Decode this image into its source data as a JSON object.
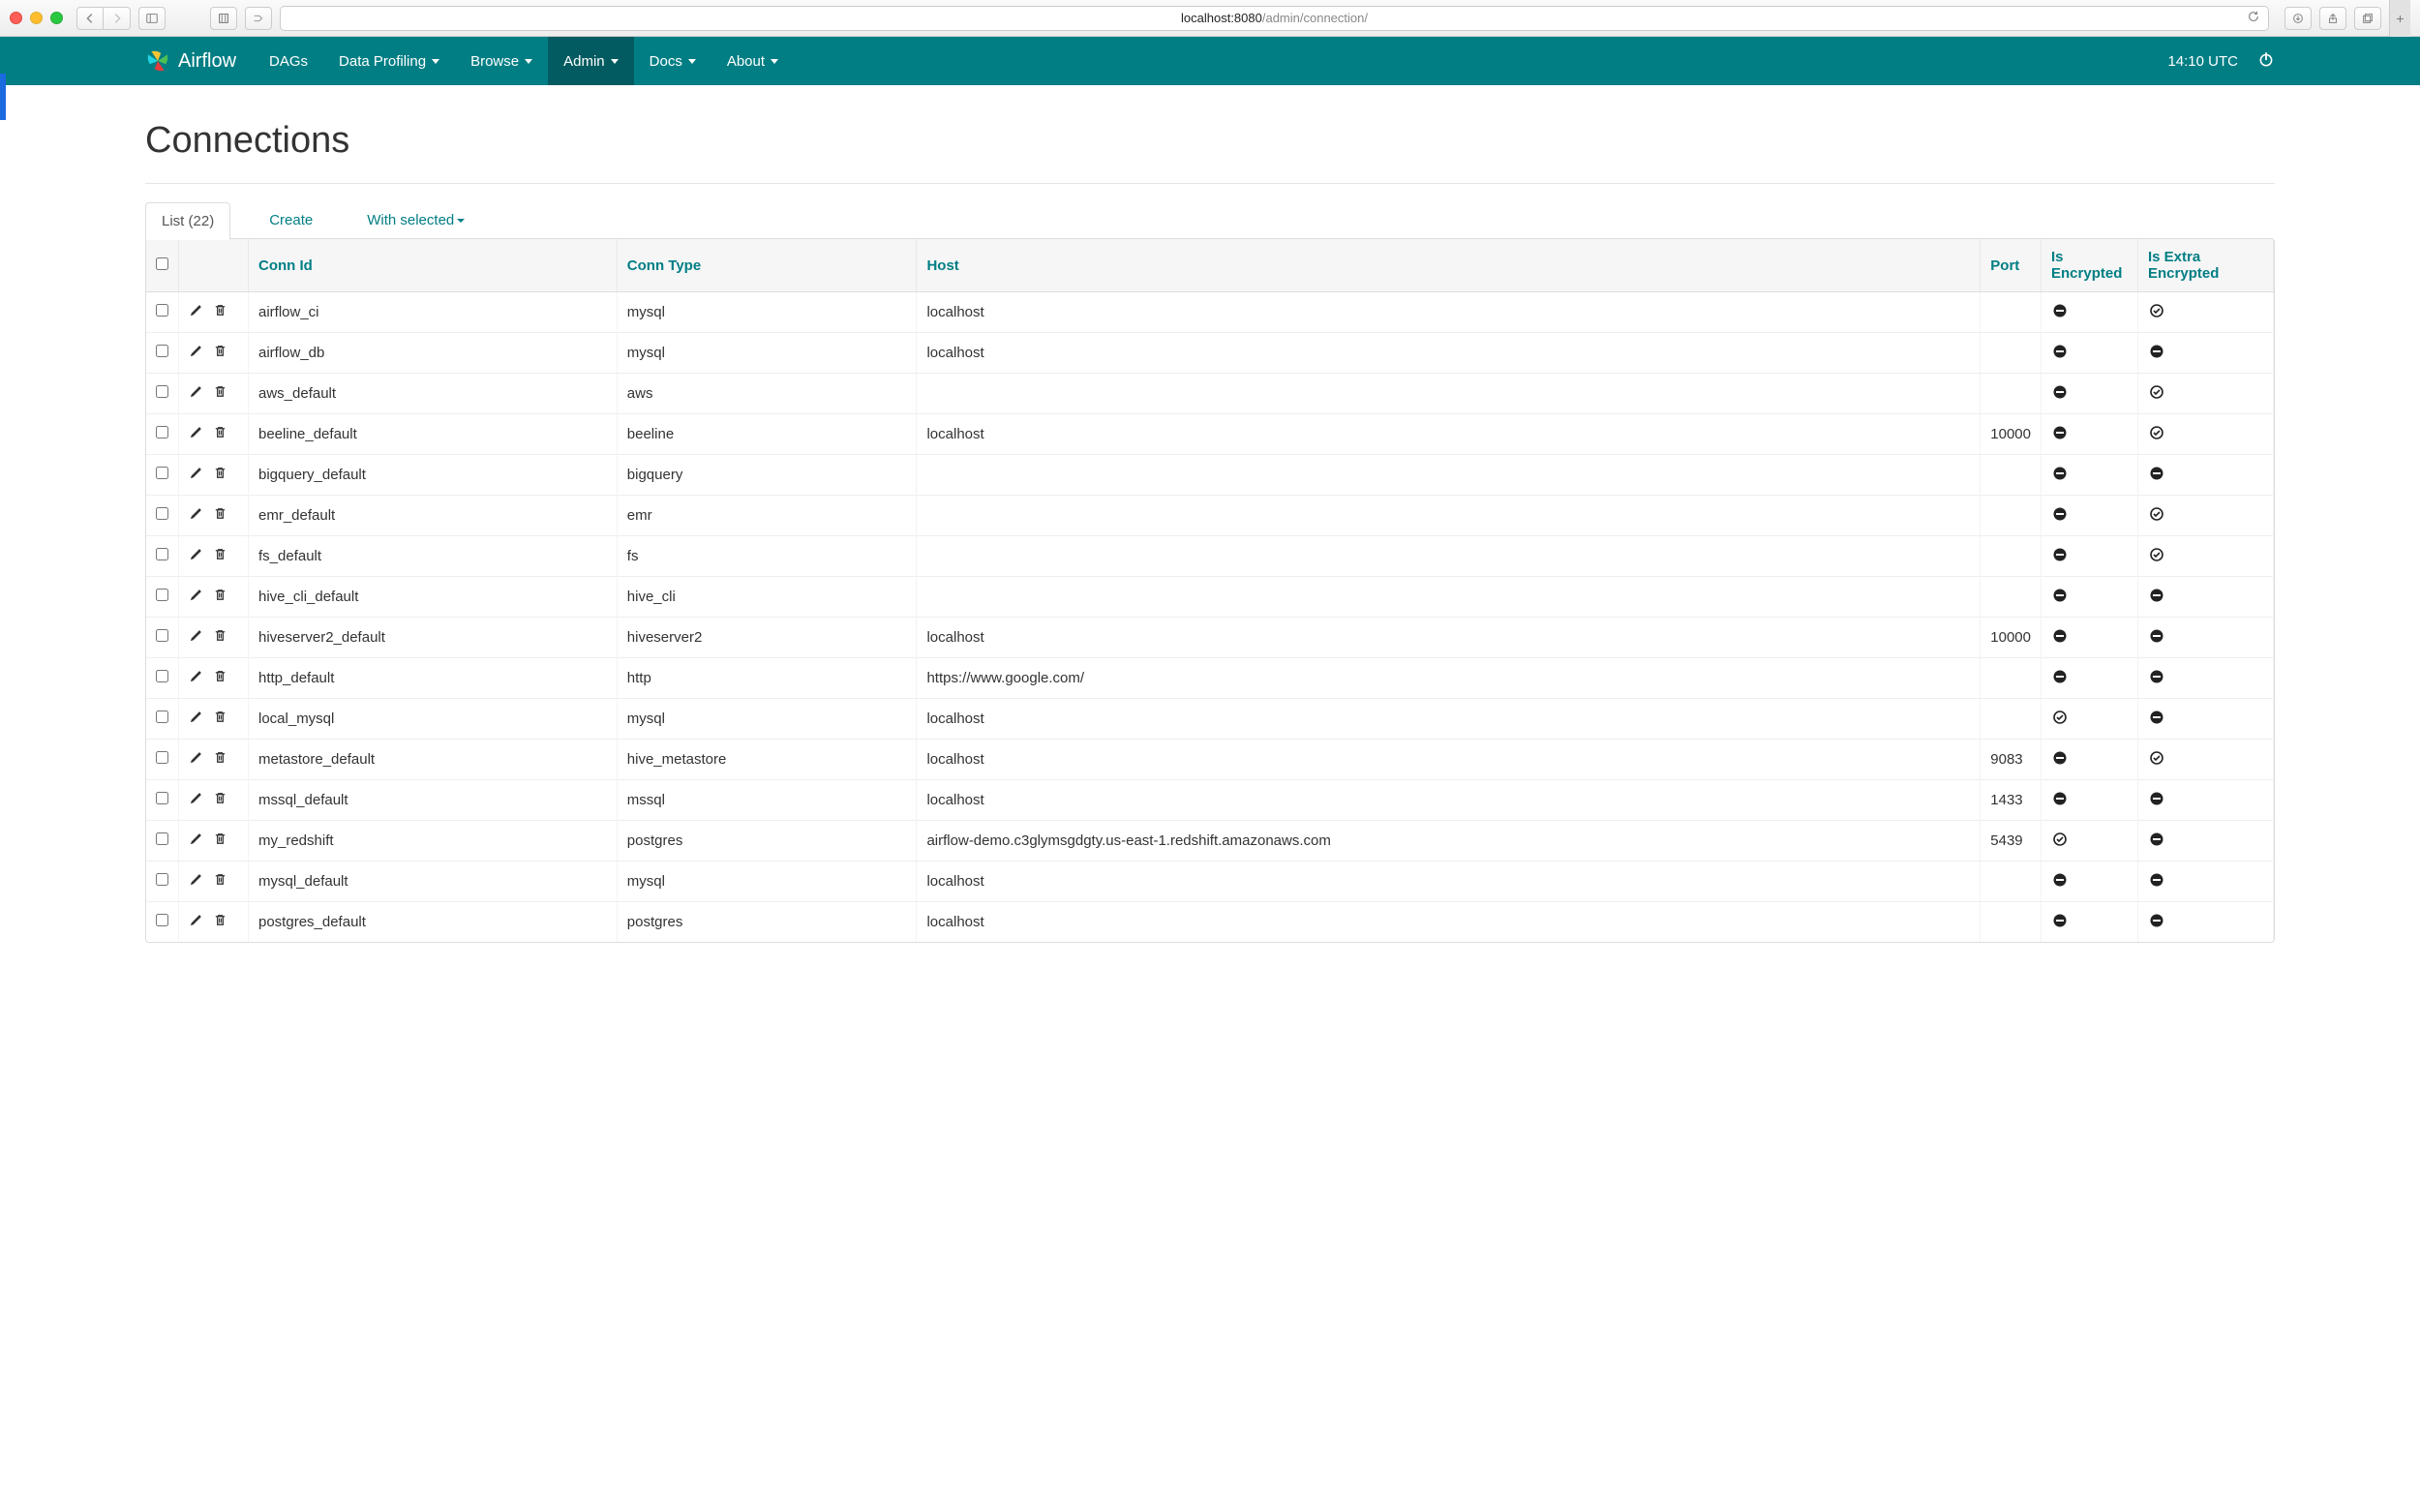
{
  "browser": {
    "url_host": "localhost:8080",
    "url_path": "/admin/connection/"
  },
  "navbar": {
    "brand": "Airflow",
    "items": [
      {
        "label": "DAGs",
        "dropdown": false,
        "active": false
      },
      {
        "label": "Data Profiling",
        "dropdown": true,
        "active": false
      },
      {
        "label": "Browse",
        "dropdown": true,
        "active": false
      },
      {
        "label": "Admin",
        "dropdown": true,
        "active": true
      },
      {
        "label": "Docs",
        "dropdown": true,
        "active": false
      },
      {
        "label": "About",
        "dropdown": true,
        "active": false
      }
    ],
    "clock": "14:10 UTC"
  },
  "page": {
    "title": "Connections",
    "tabs": {
      "list": "List (22)",
      "create": "Create",
      "with_selected": "With selected"
    },
    "columns": {
      "conn_id": "Conn Id",
      "conn_type": "Conn Type",
      "host": "Host",
      "port": "Port",
      "is_encrypted": "Is Encrypted",
      "is_extra_encrypted": "Is Extra Encrypted"
    },
    "rows": [
      {
        "conn_id": "airflow_ci",
        "conn_type": "mysql",
        "host": "localhost",
        "port": "",
        "enc": "no",
        "xenc": "yes"
      },
      {
        "conn_id": "airflow_db",
        "conn_type": "mysql",
        "host": "localhost",
        "port": "",
        "enc": "no",
        "xenc": "no"
      },
      {
        "conn_id": "aws_default",
        "conn_type": "aws",
        "host": "",
        "port": "",
        "enc": "no",
        "xenc": "yes"
      },
      {
        "conn_id": "beeline_default",
        "conn_type": "beeline",
        "host": "localhost",
        "port": "10000",
        "enc": "no",
        "xenc": "yes"
      },
      {
        "conn_id": "bigquery_default",
        "conn_type": "bigquery",
        "host": "",
        "port": "",
        "enc": "no",
        "xenc": "no"
      },
      {
        "conn_id": "emr_default",
        "conn_type": "emr",
        "host": "",
        "port": "",
        "enc": "no",
        "xenc": "yes"
      },
      {
        "conn_id": "fs_default",
        "conn_type": "fs",
        "host": "",
        "port": "",
        "enc": "no",
        "xenc": "yes"
      },
      {
        "conn_id": "hive_cli_default",
        "conn_type": "hive_cli",
        "host": "",
        "port": "",
        "enc": "no",
        "xenc": "no"
      },
      {
        "conn_id": "hiveserver2_default",
        "conn_type": "hiveserver2",
        "host": "localhost",
        "port": "10000",
        "enc": "no",
        "xenc": "no"
      },
      {
        "conn_id": "http_default",
        "conn_type": "http",
        "host": "https://www.google.com/",
        "port": "",
        "enc": "no",
        "xenc": "no"
      },
      {
        "conn_id": "local_mysql",
        "conn_type": "mysql",
        "host": "localhost",
        "port": "",
        "enc": "yes",
        "xenc": "no"
      },
      {
        "conn_id": "metastore_default",
        "conn_type": "hive_metastore",
        "host": "localhost",
        "port": "9083",
        "enc": "no",
        "xenc": "yes"
      },
      {
        "conn_id": "mssql_default",
        "conn_type": "mssql",
        "host": "localhost",
        "port": "1433",
        "enc": "no",
        "xenc": "no"
      },
      {
        "conn_id": "my_redshift",
        "conn_type": "postgres",
        "host": "airflow-demo.c3glymsgdgty.us-east-1.redshift.amazonaws.com",
        "port": "5439",
        "enc": "yes",
        "xenc": "no"
      },
      {
        "conn_id": "mysql_default",
        "conn_type": "mysql",
        "host": "localhost",
        "port": "",
        "enc": "no",
        "xenc": "no"
      },
      {
        "conn_id": "postgres_default",
        "conn_type": "postgres",
        "host": "localhost",
        "port": "",
        "enc": "no",
        "xenc": "no"
      }
    ]
  }
}
